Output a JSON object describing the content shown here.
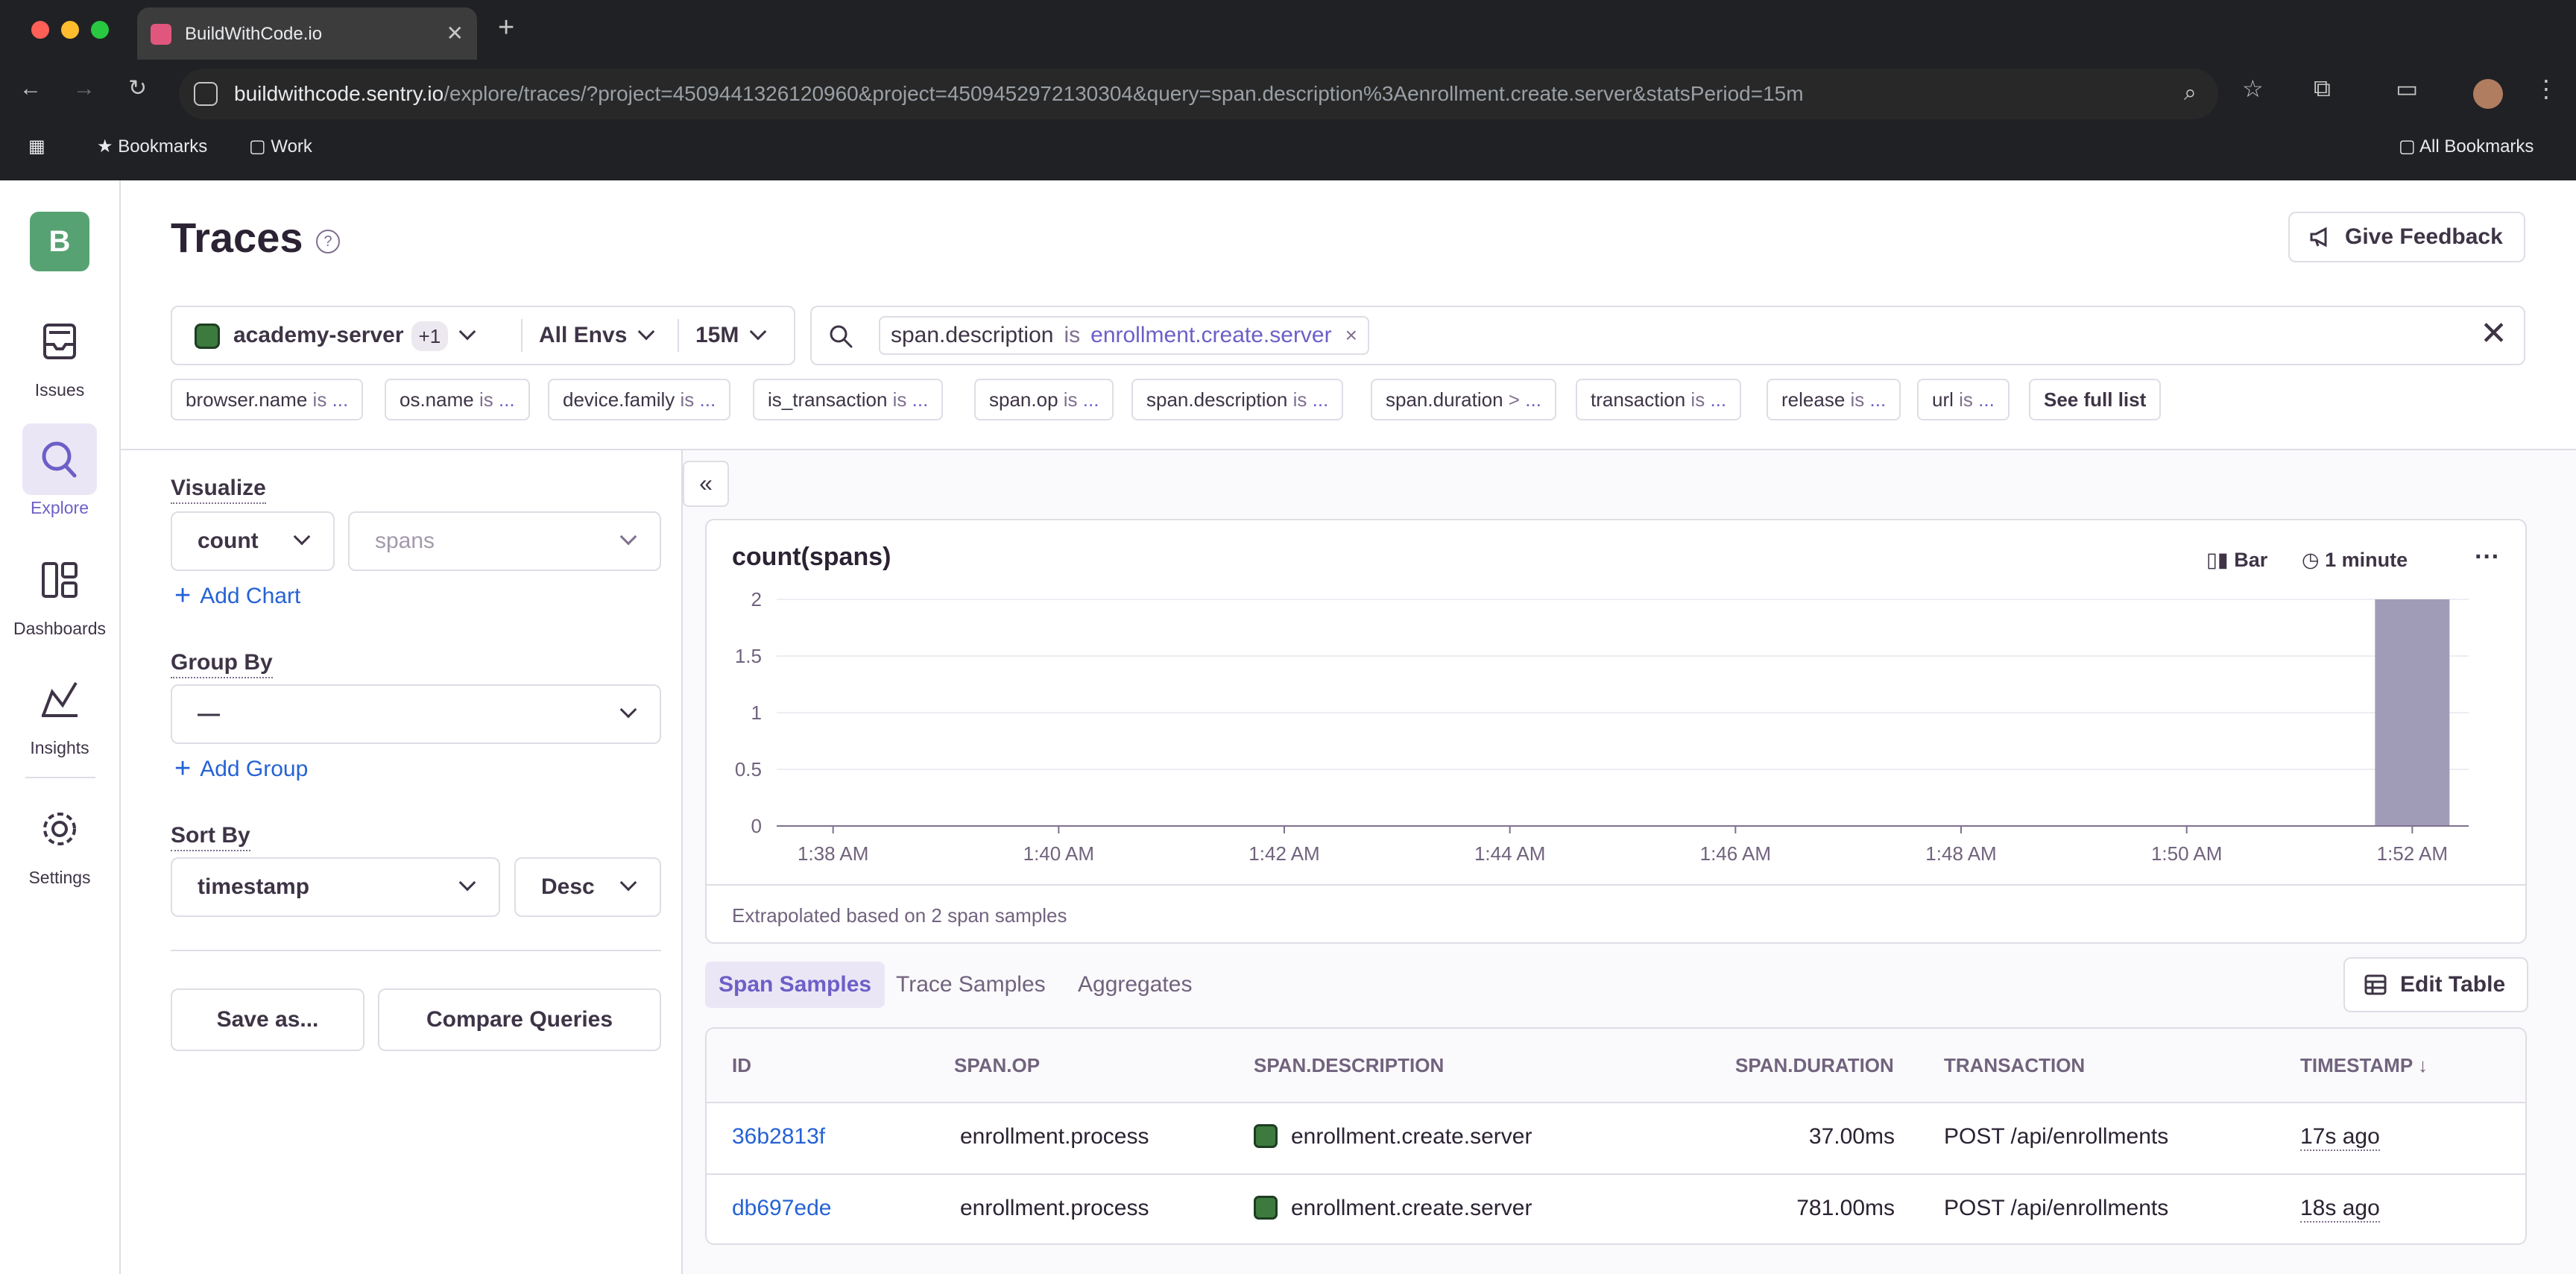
{
  "browser": {
    "tab_title": "BuildWithCode.io",
    "url_host": "buildwithcode.sentry.io",
    "url_path": "/explore/traces/?project=4509441326120960&project=4509452972130304&query=span.description%3Aenrollment.create.server&statsPeriod=15m",
    "bookmarks": [
      "Bookmarks",
      "Work"
    ],
    "all_bookmarks": "All Bookmarks"
  },
  "org_initial": "B",
  "nav": {
    "items": [
      {
        "label": "Issues",
        "icon": "inbox-icon"
      },
      {
        "label": "Explore",
        "icon": "search-icon"
      },
      {
        "label": "Dashboards",
        "icon": "dashboard-icon"
      },
      {
        "label": "Insights",
        "icon": "chart-icon"
      },
      {
        "label": "Settings",
        "icon": "gear-icon"
      }
    ],
    "active": "Explore"
  },
  "page": {
    "title": "Traces",
    "feedback": "Give Feedback"
  },
  "filters": {
    "project": "academy-server",
    "project_count": "+1",
    "env": "All Envs",
    "period": "15M"
  },
  "search": {
    "key": "span.description",
    "op": "is",
    "value": "enrollment.create.server"
  },
  "pills": [
    {
      "key": "browser.name",
      "op": "is",
      "val": "..."
    },
    {
      "key": "os.name",
      "op": "is",
      "val": "..."
    },
    {
      "key": "device.family",
      "op": "is",
      "val": "..."
    },
    {
      "key": "is_transaction",
      "op": "is",
      "val": "..."
    },
    {
      "key": "span.op",
      "op": "is",
      "val": "..."
    },
    {
      "key": "span.description",
      "op": "is",
      "val": "..."
    },
    {
      "key": "span.duration",
      "op": ">",
      "val": "..."
    },
    {
      "key": "transaction",
      "op": "is",
      "val": "..."
    },
    {
      "key": "release",
      "op": "is",
      "val": "..."
    },
    {
      "key": "url",
      "op": "is",
      "val": "..."
    }
  ],
  "see_full_list": "See full list",
  "panel": {
    "visualize_label": "Visualize",
    "agg": "count",
    "field": "spans",
    "add_chart": "Add Chart",
    "group_by_label": "Group By",
    "group_value": "—",
    "add_group": "Add Group",
    "sort_by_label": "Sort By",
    "sort_field": "timestamp",
    "sort_order": "Desc",
    "save_as": "Save as...",
    "compare": "Compare Queries"
  },
  "chart": {
    "title": "count(spans)",
    "type_label": "Bar",
    "interval_label": "1 minute",
    "more": "···",
    "footer": "Extrapolated based on 2 span samples"
  },
  "chart_data": {
    "type": "bar",
    "title": "count(spans)",
    "x": [
      "1:38 AM",
      "1:39 AM",
      "1:40 AM",
      "1:41 AM",
      "1:42 AM",
      "1:43 AM",
      "1:44 AM",
      "1:45 AM",
      "1:46 AM",
      "1:47 AM",
      "1:48 AM",
      "1:49 AM",
      "1:50 AM",
      "1:51 AM",
      "1:52 AM"
    ],
    "values": [
      0,
      0,
      0,
      0,
      0,
      0,
      0,
      0,
      0,
      0,
      0,
      0,
      0,
      0,
      2
    ],
    "xticks": [
      "1:38 AM",
      "1:40 AM",
      "1:42 AM",
      "1:44 AM",
      "1:46 AM",
      "1:48 AM",
      "1:50 AM",
      "1:52 AM"
    ],
    "yticks": [
      "0",
      "0.5",
      "1",
      "1.5",
      "2"
    ],
    "ylim": [
      0,
      2
    ],
    "bar_color": "#a09cb8",
    "grid": true
  },
  "tabs": [
    "Span Samples",
    "Trace Samples",
    "Aggregates"
  ],
  "active_tab": "Span Samples",
  "edit_table": "Edit Table",
  "table": {
    "columns": [
      "ID",
      "SPAN.OP",
      "SPAN.DESCRIPTION",
      "SPAN.DURATION",
      "TRANSACTION",
      "TIMESTAMP"
    ],
    "sort_indicator": "↓",
    "rows": [
      {
        "id": "36b2813f",
        "op": "enrollment.process",
        "desc": "enrollment.create.server",
        "duration": "37.00ms",
        "transaction": "POST /api/enrollments",
        "timestamp": "17s ago"
      },
      {
        "id": "db697ede",
        "op": "enrollment.process",
        "desc": "enrollment.create.server",
        "duration": "781.00ms",
        "transaction": "POST /api/enrollments",
        "timestamp": "18s ago"
      }
    ]
  }
}
